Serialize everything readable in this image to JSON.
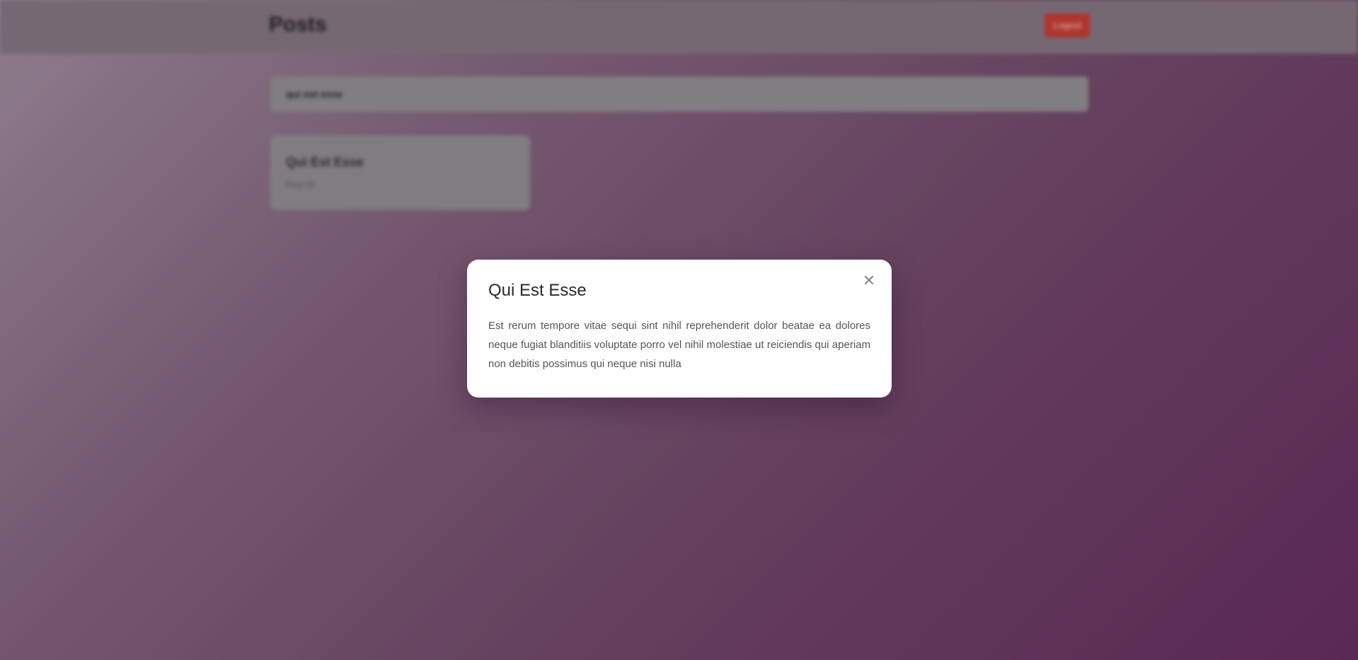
{
  "header": {
    "title": "Posts",
    "logout_label": "Logout"
  },
  "search": {
    "value": "qui est esse"
  },
  "posts": [
    {
      "title": "Qui Est Esse",
      "author": "Post #2"
    }
  ],
  "modal": {
    "title": "Qui Est Esse",
    "body": "Est rerum tempore vitae sequi sint nihil reprehenderit dolor beatae ea dolores neque fugiat blanditiis voluptate porro vel nihil molestiae ut reiciendis qui aperiam non debitis possimus qui neque nisi nulla",
    "close_icon": "close-icon",
    "close_glyph": "✕"
  },
  "colors": {
    "accent_button": "#c0392b",
    "background_gradient_end": "#5f2a58"
  }
}
